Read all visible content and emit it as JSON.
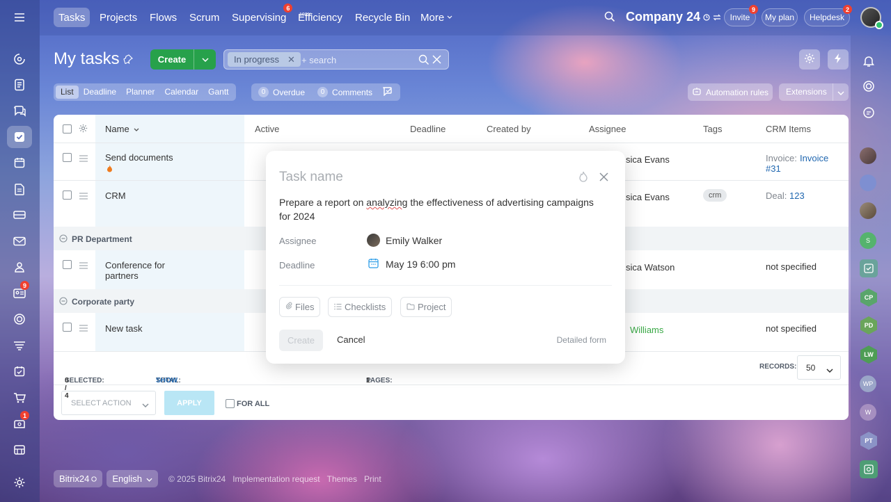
{
  "topnav": {
    "items": [
      {
        "label": "Tasks"
      },
      {
        "label": "Projects"
      },
      {
        "label": "Flows"
      },
      {
        "label": "Scrum"
      },
      {
        "label": "Supervising",
        "badge": "6"
      },
      {
        "label": "Efficiency",
        "sup": "100%"
      },
      {
        "label": "Recycle Bin"
      },
      {
        "label": "More"
      }
    ],
    "company": "Company 24",
    "invite": "Invite",
    "invite_badge": "9",
    "my_plan": "My plan",
    "helpdesk": "Helpdesk",
    "helpdesk_badge": "2"
  },
  "leftbar": {
    "badges": {
      "contact_center": "9",
      "sites": "1"
    }
  },
  "rightbar": {
    "avatars": [
      "S",
      "CP",
      "PD",
      "LW",
      "WP",
      "W",
      "PT"
    ]
  },
  "page": {
    "title": "My tasks",
    "create_label": "Create",
    "filter_chip": "In progress",
    "search_placeholder": "+ search"
  },
  "views": {
    "tabs": [
      "List",
      "Deadline",
      "Planner",
      "Calendar",
      "Gantt"
    ],
    "overdue_count": "0",
    "overdue_label": "Overdue",
    "comments_count": "0",
    "comments_label": "Comments",
    "automation_rules": "Automation rules",
    "extensions": "Extensions"
  },
  "grid": {
    "columns": {
      "name": "Name",
      "active": "Active",
      "deadline": "Deadline",
      "created_by": "Created by",
      "assignee": "Assignee",
      "tags": "Tags",
      "crm": "CRM Items"
    },
    "rows": [
      {
        "name": "Send documents",
        "assignee": "sica Evans",
        "crm_label": "Invoice:",
        "crm_link_1": "Invoice",
        "crm_link_2": "#31"
      },
      {
        "name": "CRM",
        "assignee": "sica Evans",
        "tag": "crm",
        "crm_label": "Deal:",
        "crm_link": "123"
      },
      {
        "group": "PR Department"
      },
      {
        "name_line1": "Conference for",
        "name_line2": "partners",
        "assignee": "sica Watson",
        "crm": "not specified"
      },
      {
        "group": "Corporate party"
      },
      {
        "name": "New task",
        "assignee": "Williams",
        "crm": "not specified"
      }
    ],
    "footer": {
      "selected_label": "SELECTED:",
      "selected_value": "0 / 4",
      "total_label": "TOTAL:",
      "total_value": "SHOW",
      "pages_label": "PAGES:",
      "pages_value": "1",
      "records_label": "RECORDS:",
      "records_value": "50"
    },
    "actions": {
      "select_action": "SELECT ACTION",
      "apply": "APPLY",
      "for_all": "FOR ALL"
    }
  },
  "dialog": {
    "title_placeholder": "Task name",
    "description_part1": "Prepare a report on ",
    "description_misspelled": "analyzing",
    "description_part2": " the effectiveness of advertising campaigns for 2024",
    "assignee_label": "Assignee",
    "assignee_value": "Emily Walker",
    "deadline_label": "Deadline",
    "deadline_value": "May 19 6:00 pm",
    "files": "Files",
    "checklists": "Checklists",
    "project": "Project",
    "create": "Create",
    "cancel": "Cancel",
    "detailed_form": "Detailed form"
  },
  "footer": {
    "brand": "Bitrix24",
    "language": "English",
    "copyright": "© 2025 Bitrix24",
    "implementation": "Implementation request",
    "themes": "Themes",
    "print": "Print"
  }
}
